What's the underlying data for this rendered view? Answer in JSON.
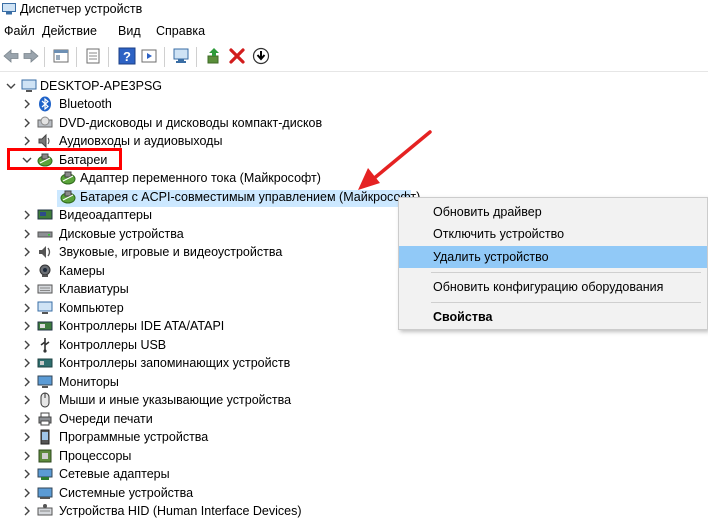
{
  "window": {
    "title": "Диспетчер устройств",
    "icon": "device-manager-icon"
  },
  "menu": [
    "Файл",
    "Действие",
    "Вид",
    "Справка"
  ],
  "toolbar": {
    "buttons": [
      "back-arrow-icon",
      "forward-arrow-icon",
      "properties-icon",
      "show-hidden-icon",
      "help-icon",
      "view-icon",
      "scan-hardware-icon",
      "update-driver-icon",
      "remove-device-icon",
      "install-icon"
    ]
  },
  "tree": {
    "root": "DESKTOP-APE3PSG",
    "categories": [
      {
        "label": "Bluetooth",
        "icon": "bluetooth-icon"
      },
      {
        "label": "DVD-дисководы и дисководы компакт-дисков",
        "icon": "dvd-drive-icon"
      },
      {
        "label": "Аудиовходы и аудиовыходы",
        "icon": "speaker-icon"
      },
      {
        "label": "Батареи",
        "icon": "battery-icon",
        "expanded": true,
        "children": [
          {
            "label": "Адаптер переменного тока (Майкрософт)",
            "icon": "battery-icon"
          },
          {
            "label": "Батарея с ACPI-совместимым управлением (Майкрософт)",
            "icon": "battery-icon",
            "selected": true
          }
        ]
      },
      {
        "label": "Видеоадаптеры",
        "icon": "display-adapter-icon"
      },
      {
        "label": "Дисковые устройства",
        "icon": "disk-drive-icon"
      },
      {
        "label": "Звуковые, игровые и видеоустройства",
        "icon": "sound-icon"
      },
      {
        "label": "Камеры",
        "icon": "camera-icon"
      },
      {
        "label": "Клавиатуры",
        "icon": "keyboard-icon"
      },
      {
        "label": "Компьютер",
        "icon": "computer-icon"
      },
      {
        "label": "Контроллеры IDE ATA/ATAPI",
        "icon": "ide-controller-icon"
      },
      {
        "label": "Контроллеры USB",
        "icon": "usb-icon"
      },
      {
        "label": "Контроллеры запоминающих устройств",
        "icon": "storage-controller-icon"
      },
      {
        "label": "Мониторы",
        "icon": "monitor-icon"
      },
      {
        "label": "Мыши и иные указывающие устройства",
        "icon": "mouse-icon"
      },
      {
        "label": "Очереди печати",
        "icon": "printer-icon"
      },
      {
        "label": "Программные устройства",
        "icon": "software-device-icon"
      },
      {
        "label": "Процессоры",
        "icon": "processor-icon"
      },
      {
        "label": "Сетевые адаптеры",
        "icon": "network-adapter-icon"
      },
      {
        "label": "Системные устройства",
        "icon": "system-device-icon"
      },
      {
        "label": "Устройства HID (Human Interface Devices)",
        "icon": "hid-icon"
      }
    ]
  },
  "context_menu": {
    "items": [
      "Обновить драйвер",
      "Отключить устройство",
      "Удалить устройство",
      "Обновить конфигурацию оборудования",
      "Свойства"
    ],
    "highlighted": "Удалить устройство"
  },
  "annotations": {
    "box_color": "#ff0000",
    "arrow_color": "#e52222"
  },
  "colors": {
    "selection": "#cce8ff",
    "menu_highlight": "#91c9f7",
    "menu_background": "#f2f2f2"
  }
}
